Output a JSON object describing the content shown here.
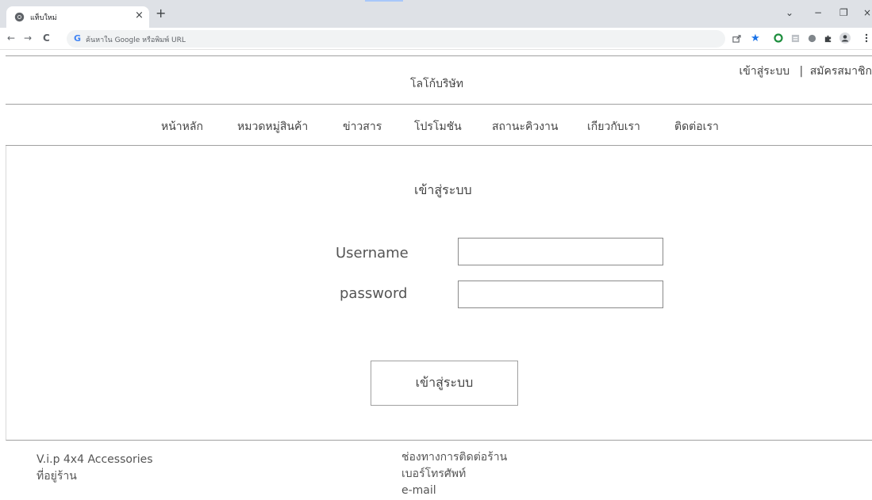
{
  "browser": {
    "tab_title": "แท็บใหม่",
    "tab_close": "×",
    "new_tab": "+",
    "window_controls": {
      "dropdown": "⌄",
      "minimize": "−",
      "restore": "❐",
      "close": "×"
    },
    "nav": {
      "back": "←",
      "forward": "→",
      "reload": "C"
    },
    "omnibox_brand": "G",
    "omnibox_placeholder": "ค้นหาใน Google หรือพิมพ์ URL",
    "icons": [
      "share-icon",
      "bookmark-star-icon",
      "extension-green-icon",
      "extension-pdf-icon",
      "extension-grey-icon",
      "extensions-puzzle-icon",
      "profile-icon",
      "menu-kebab-icon"
    ]
  },
  "header": {
    "logo": "โลโก้บริษัท",
    "login_link": "เข้าสู่ระบบ",
    "separator": "|",
    "register_link": "สมัครสมาชิก"
  },
  "nav": {
    "items": [
      "หน้าหลัก",
      "หมวดหมู่สินค้า",
      "ข่าวสาร",
      "โปรโมชัน",
      "สถานะคิวงาน",
      "เกียวกับเรา",
      "ติดต่อเรา"
    ]
  },
  "login": {
    "title": "เข้าสู่ระบบ",
    "username_label": "Username",
    "username_value": "",
    "password_label": "password",
    "password_value": "",
    "submit_label": "เข้าสู่ระบบ"
  },
  "footer": {
    "shop_name": "V.i.p 4x4 Accessories",
    "address_label": "ที่อยู่ร้าน",
    "contact_title": "ช่องทางการติดต่อร้าน",
    "phone_label": "เบอร์โทรศัพท์",
    "email_label": "e-mail"
  }
}
